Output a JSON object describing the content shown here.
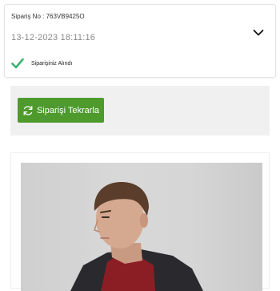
{
  "order": {
    "number_label": "Sipariş No : 763VB9425O",
    "date": "13-12-2023 18:11:16",
    "status_text": "Siparişiniz Alındı",
    "expand_icon": "chevron-down-icon",
    "status_icon": "check-icon",
    "status_color": "#3cb371"
  },
  "reorder": {
    "button_label": "Siparişi Tekrarla",
    "button_icon": "refresh-icon",
    "button_color": "#4e9a2c"
  },
  "product": {
    "image": "product-photo"
  }
}
